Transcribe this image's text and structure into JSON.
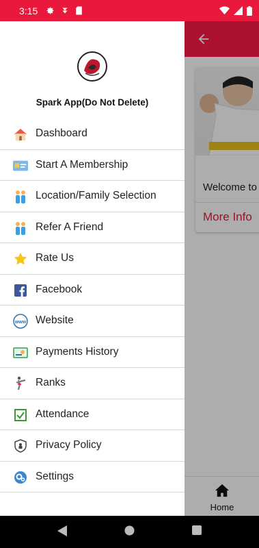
{
  "status_bar": {
    "time": "3:15"
  },
  "app": {
    "card": {
      "welcome": "Welcome to",
      "more_info": "More Info"
    },
    "bottom_nav": {
      "home_label": "Home"
    }
  },
  "drawer": {
    "app_name": "Spark App(Do Not Delete)",
    "menu": [
      {
        "label": "Dashboard",
        "icon": "house-icon"
      },
      {
        "label": "Start A Membership",
        "icon": "membership-card-icon"
      },
      {
        "label": "Location/Family Selection",
        "icon": "family-icon"
      },
      {
        "label": "Refer A Friend",
        "icon": "refer-friend-icon"
      },
      {
        "label": "Rate Us",
        "icon": "star-icon"
      },
      {
        "label": "Facebook",
        "icon": "facebook-icon"
      },
      {
        "label": "Website",
        "icon": "www-icon"
      },
      {
        "label": "Payments History",
        "icon": "payments-icon"
      },
      {
        "label": "Ranks",
        "icon": "karate-kick-icon"
      },
      {
        "label": "Attendance",
        "icon": "checkbox-icon"
      },
      {
        "label": "Privacy Policy",
        "icon": "shield-icon"
      },
      {
        "label": "Settings",
        "icon": "gears-icon"
      }
    ]
  },
  "colors": {
    "accent": "#e8193c",
    "appbar": "#ff1a4a"
  }
}
